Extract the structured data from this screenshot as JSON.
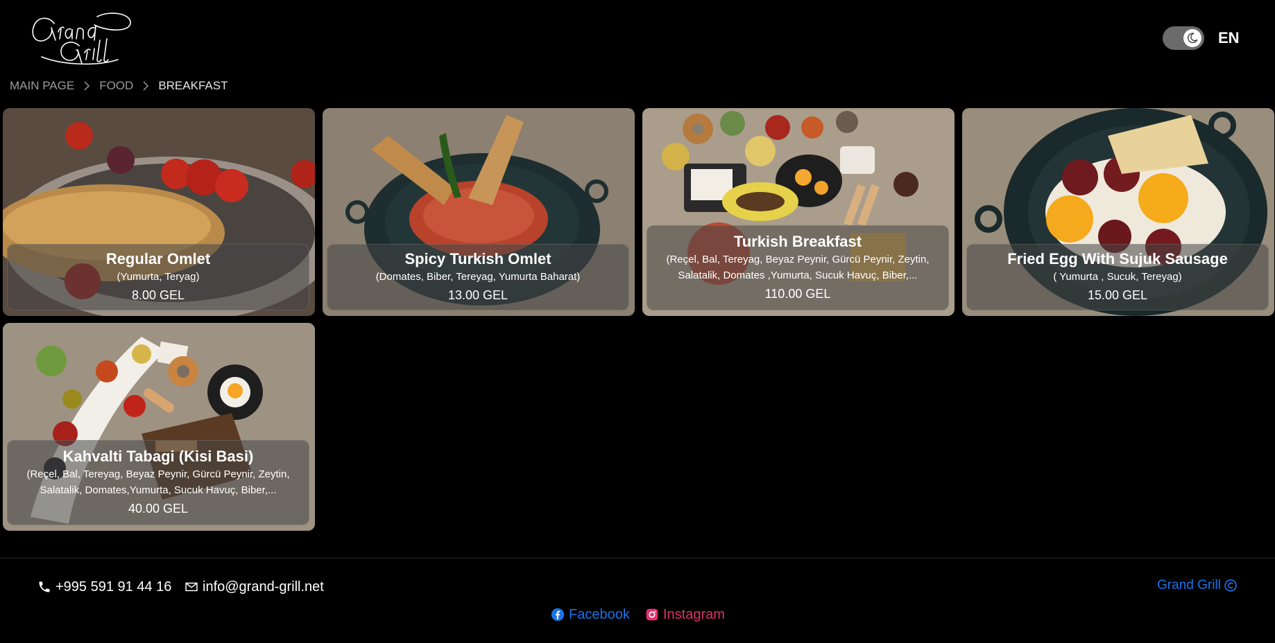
{
  "header": {
    "logo_text": "Grand Grill",
    "language": "EN",
    "theme_icon": "moon-icon"
  },
  "breadcrumb": {
    "items": [
      "MAIN PAGE",
      "FOOD",
      "BREAKFAST"
    ]
  },
  "menu_items": [
    {
      "title": "Regular Omlet",
      "description": "(Yumurta, Teryag)",
      "price": "8.00 GEL"
    },
    {
      "title": "Spicy Turkish Omlet",
      "description": "(Domates, Biber, Tereyag, Yumurta Baharat)",
      "price": "13.00 GEL"
    },
    {
      "title": "Turkish Breakfast",
      "description_line1": "(Reçel, Bal, Tereyag, Beyaz Peynir, Gürcü Peynir, Zeytin,",
      "description_line2": "Salatalik, Domates ,Yumurta, Sucuk Havuç, Biber,...",
      "price": "110.00 GEL"
    },
    {
      "title": "Fried Egg With Sujuk Sausage",
      "description": "( Yumurta , Sucuk, Tereyag)",
      "price": "15.00 GEL"
    },
    {
      "title": "Kahvalti Tabagi (Kisi Basi)",
      "description_line1": "(Reçel, Bal, Tereyag, Beyaz Peynir, Gürcü Peynir, Zeytin,",
      "description_line2": "Salatalik, Domates,Yumurta, Sucuk Havuç, Biber,...",
      "price": "40.00 GEL"
    }
  ],
  "footer": {
    "phone": "+995 591 91 44 16",
    "email": "info@grand-grill.net",
    "brand": "Grand Grill",
    "facebook": "Facebook",
    "instagram": "Instagram"
  },
  "colors": {
    "background": "#000000",
    "link_blue": "#1a73e8",
    "instagram_pink": "#e1306c",
    "toggle_gray": "#6b6b6b"
  }
}
